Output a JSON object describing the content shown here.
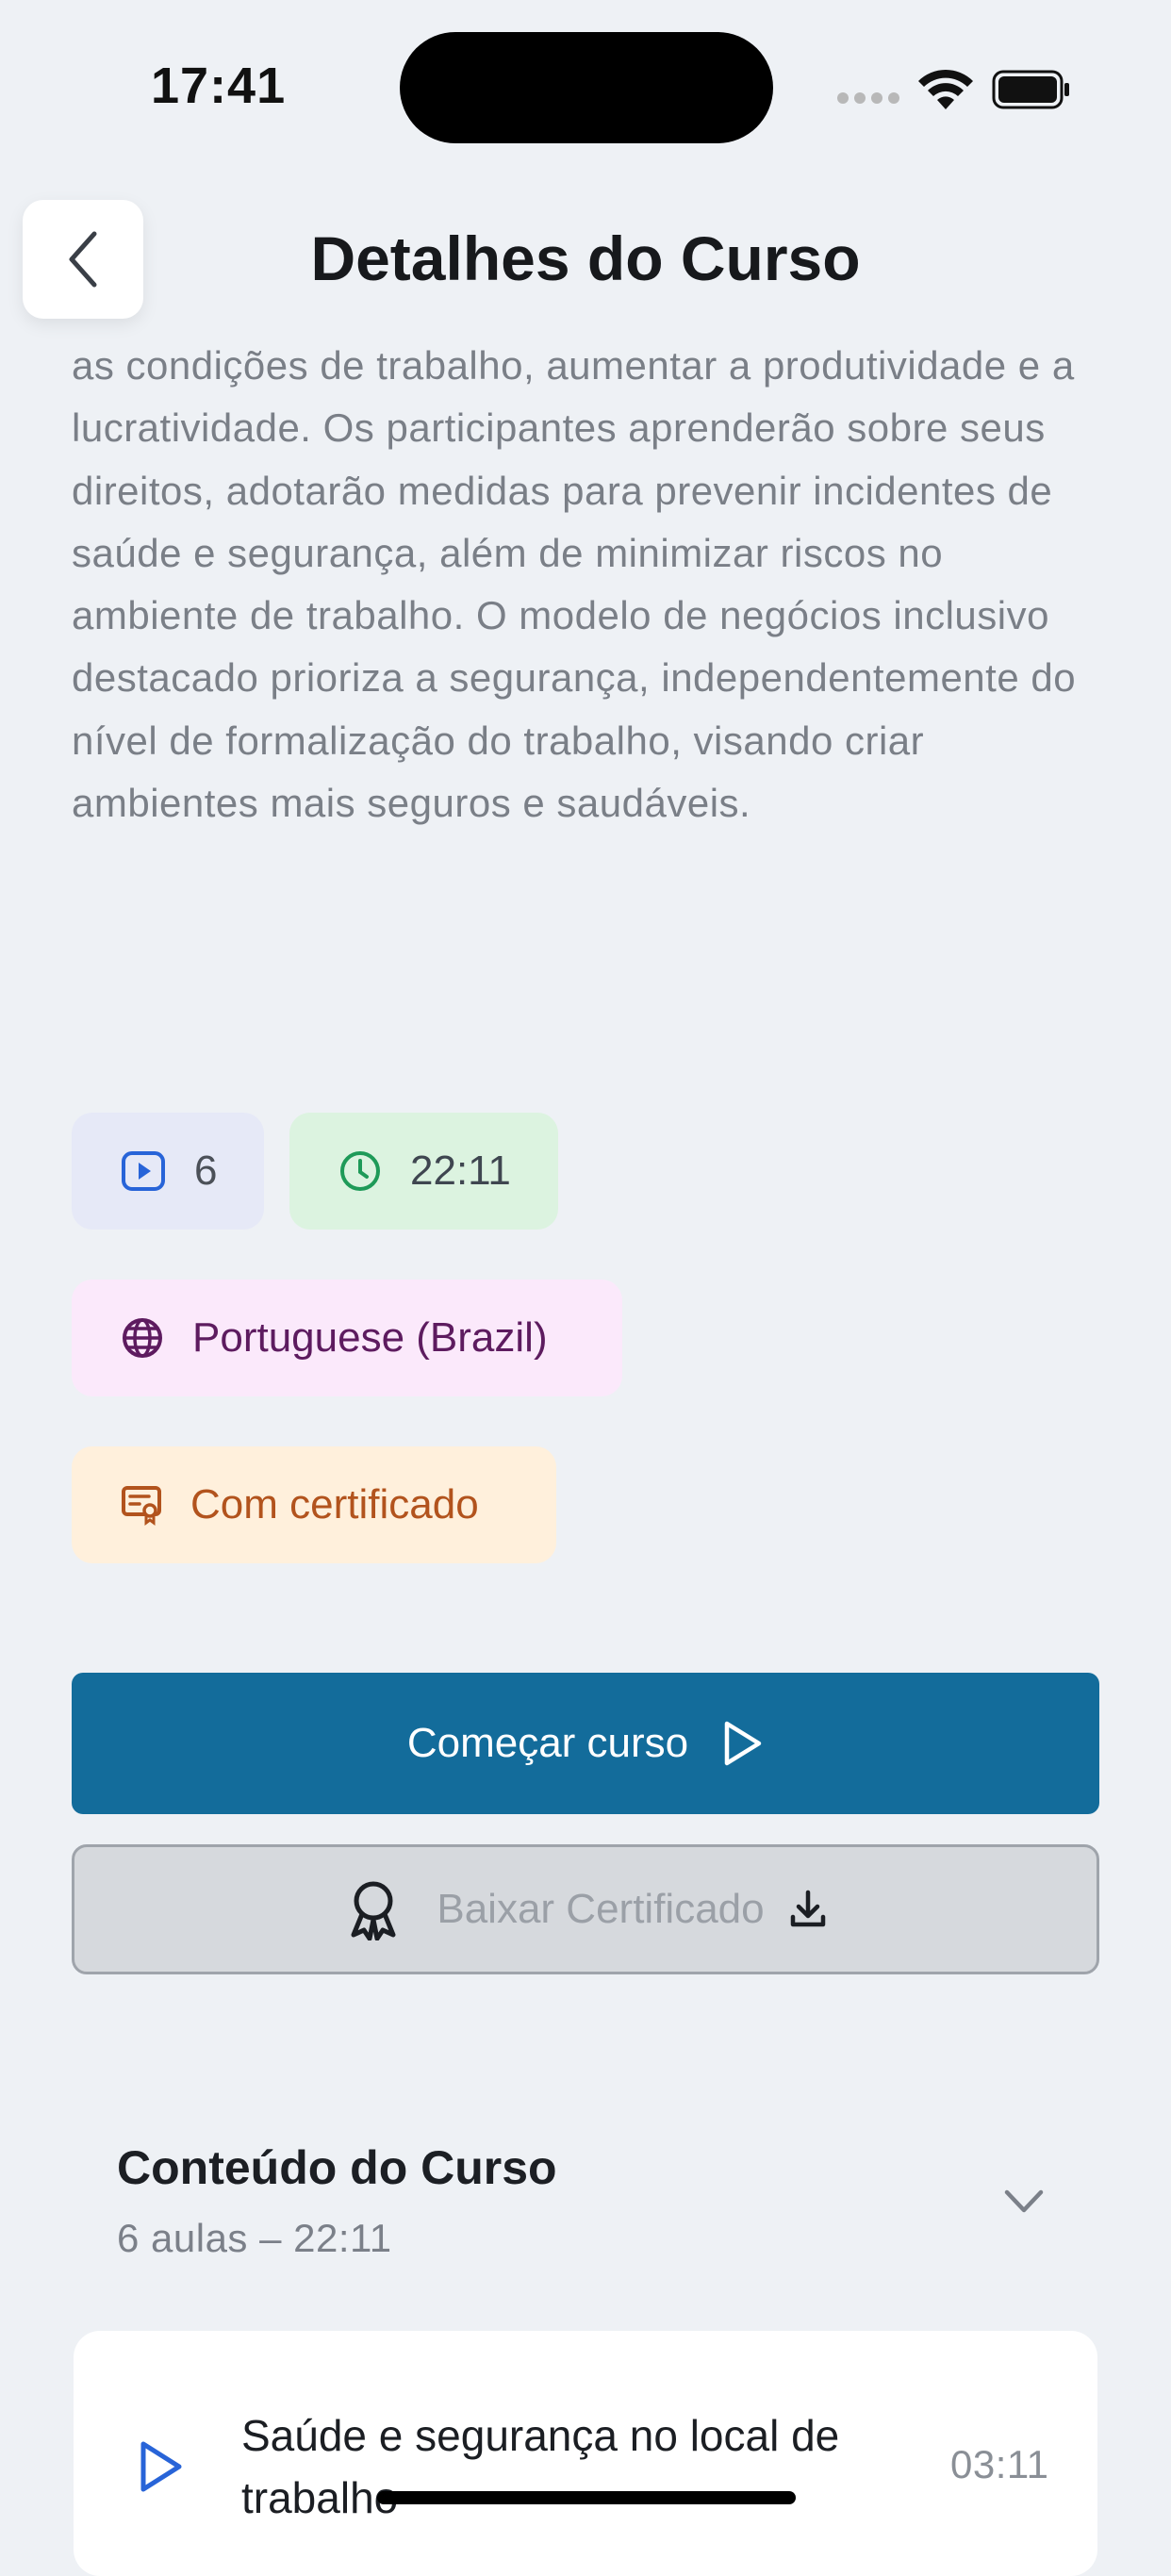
{
  "status_bar": {
    "time": "17:41"
  },
  "header": {
    "title": "Detalhes do Curso"
  },
  "description": "as condições de trabalho, aumentar a produtividade e a lucratividade. Os participantes aprenderão sobre seus direitos, adotarão medidas para prevenir incidentes de saúde e segurança, além de minimizar riscos no ambiente de trabalho. O modelo de negócios inclusivo destacado prioriza a segurança, independentemente do nível de formalização do trabalho, visando criar ambientes mais seguros e saudáveis.",
  "chips": {
    "lessons": "6",
    "duration": "22:11",
    "language": "Portuguese (Brazil)",
    "certificate": "Com certificado"
  },
  "buttons": {
    "start": "Começar curso",
    "download_certificate": "Baixar Certificado"
  },
  "course_content": {
    "title": "Conteúdo do Curso",
    "summary": "6 aulas – 22:11",
    "lessons": [
      {
        "title": "Saúde e segurança no local de trabalho",
        "duration": "03:11"
      }
    ]
  },
  "icons": {
    "back": "chevron-left-icon",
    "lessons": "video-icon",
    "duration": "clock-icon",
    "language": "globe-icon",
    "certificate": "certificate-icon",
    "start": "play-icon",
    "award": "award-icon",
    "download": "download-icon",
    "expand": "chevron-down-icon",
    "lesson": "play-icon"
  },
  "colors": {
    "primary": "#136c9b",
    "background": "#eef1f5",
    "lesson_icon": "#2864d8",
    "duration_icon": "#1e9a58",
    "language_text": "#5d1b5f",
    "certificate_text": "#b2531d"
  }
}
